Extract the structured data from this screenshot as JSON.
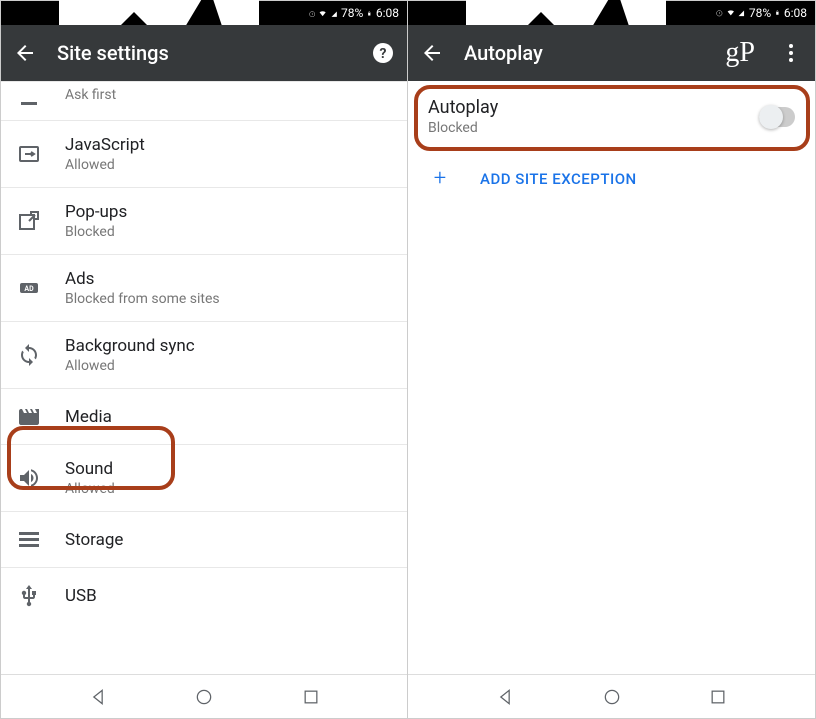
{
  "status": {
    "battery": "78%",
    "time": "6:08"
  },
  "left": {
    "title": "Site settings",
    "items": [
      {
        "icon": "location",
        "label": "",
        "sub": "Ask first",
        "partial": true
      },
      {
        "icon": "javascript",
        "label": "JavaScript",
        "sub": "Allowed"
      },
      {
        "icon": "popup",
        "label": "Pop-ups",
        "sub": "Blocked"
      },
      {
        "icon": "ads",
        "label": "Ads",
        "sub": "Blocked from some sites"
      },
      {
        "icon": "sync",
        "label": "Background sync",
        "sub": "Allowed"
      },
      {
        "icon": "media",
        "label": "Media",
        "sub": ""
      },
      {
        "icon": "sound",
        "label": "Sound",
        "sub": "Allowed"
      },
      {
        "icon": "storage",
        "label": "Storage",
        "sub": ""
      },
      {
        "icon": "usb",
        "label": "USB",
        "sub": ""
      }
    ]
  },
  "right": {
    "title": "Autoplay",
    "toggle": {
      "label": "Autoplay",
      "sub": "Blocked",
      "on": false
    },
    "add_label": "ADD SITE EXCEPTION"
  }
}
